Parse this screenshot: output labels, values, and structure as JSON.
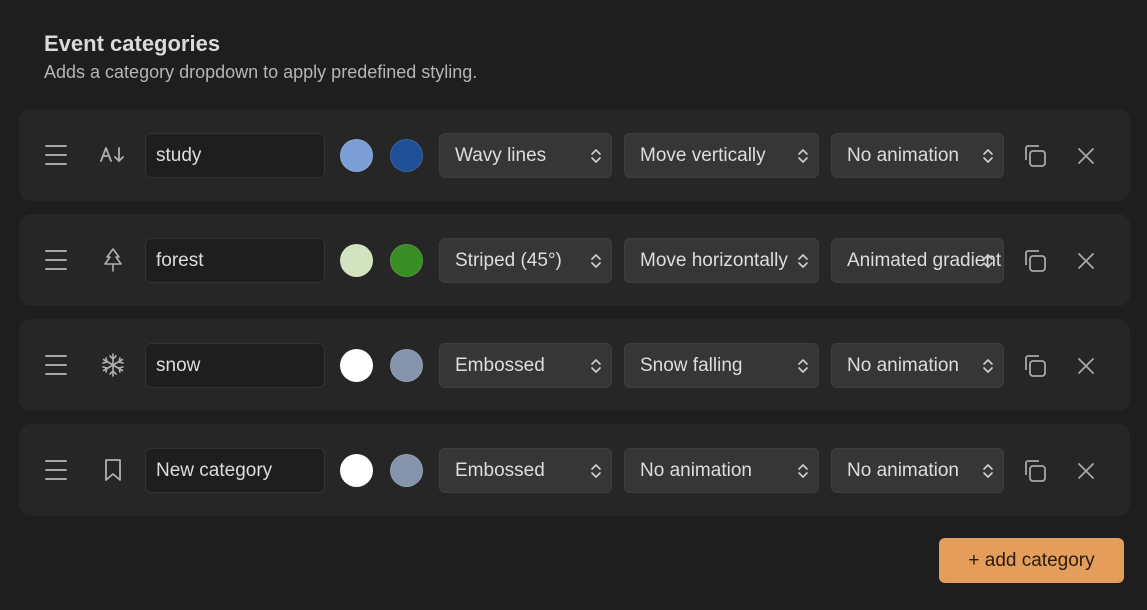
{
  "header": {
    "title": "Event categories",
    "subtitle": "Adds a category dropdown to apply predefined styling."
  },
  "categories": [
    {
      "icon": "sort-alpha-down-icon",
      "name": "study",
      "color_light": "#7b9fd4",
      "color_dark": "#1f4f94",
      "pattern": "Wavy lines",
      "motion": "Move vertically",
      "animation": "No animation"
    },
    {
      "icon": "tree-icon",
      "name": "forest",
      "color_light": "#d2e3bf",
      "color_dark": "#3a8c24",
      "pattern": "Striped (45°)",
      "motion": "Move horizontally",
      "animation": "Animated gradient"
    },
    {
      "icon": "snowflake-icon",
      "name": "snow",
      "color_light": "#ffffff",
      "color_dark": "#8594ab",
      "pattern": "Embossed",
      "motion": "Snow falling",
      "animation": "No animation"
    },
    {
      "icon": "bookmark-icon",
      "name": "New category",
      "color_light": "#ffffff",
      "color_dark": "#8594ab",
      "pattern": "Embossed",
      "motion": "No animation",
      "animation": "No animation"
    }
  ],
  "add_button": {
    "label": "+ add category"
  },
  "colors": {
    "background": "#1e1e1e",
    "row_background": "#262626",
    "select_background": "#363636",
    "accent": "#e59d5b"
  }
}
